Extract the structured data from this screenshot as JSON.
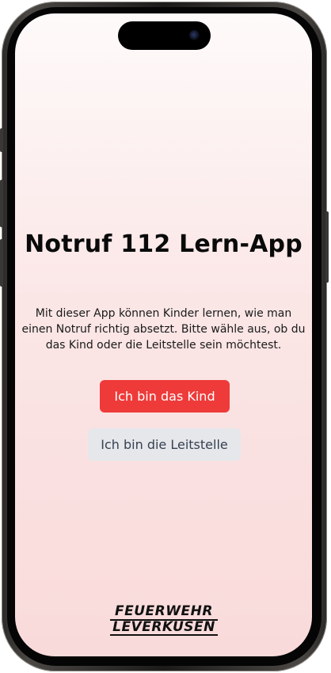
{
  "app": {
    "title": "Notruf 112 Lern-App",
    "intro": "Mit dieser App können Kinder lernen, wie man einen Notruf richtig absetzt. Bitte wähle aus, ob du das Kind oder die Leitstelle sein möchtest."
  },
  "buttons": {
    "child_label": "Ich bin das Kind",
    "control_center_label": "Ich bin die Leitstelle"
  },
  "logo": {
    "line1": "FEUERWEHR",
    "line2": "LEVERKUSEN"
  },
  "colors": {
    "primary_button": "#ef3a3a",
    "secondary_button": "#e5e7eb",
    "background_top": "#fefafa",
    "background_bottom": "#f9dada"
  }
}
